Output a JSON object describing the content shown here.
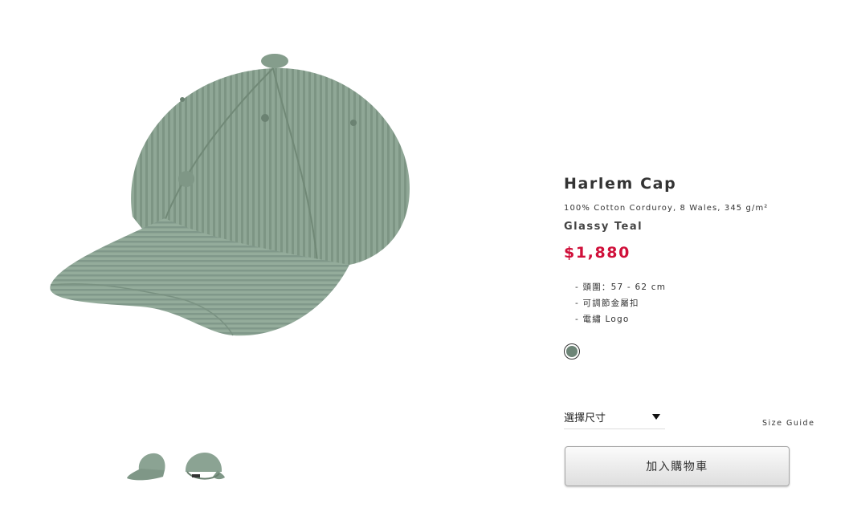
{
  "product": {
    "title": "Harlem Cap",
    "description": "100% Cotton Corduroy, 8 Wales, 345 g/m²",
    "color_name": "Glassy Teal",
    "price": "$1,880",
    "features": [
      "- 頭圍：57 - 62 cm",
      "- 可調節金屬扣",
      "- 電繡 Logo"
    ]
  },
  "swatch": {
    "color": "#6d8577"
  },
  "size_select": {
    "label": "選擇尺寸"
  },
  "size_guide": {
    "label": "Size Guide"
  },
  "cart_button": {
    "label": "加入購物車"
  },
  "colors": {
    "price": "#d0103a",
    "cap": "#8aa393"
  },
  "icons": [
    "chevron-down-icon"
  ]
}
